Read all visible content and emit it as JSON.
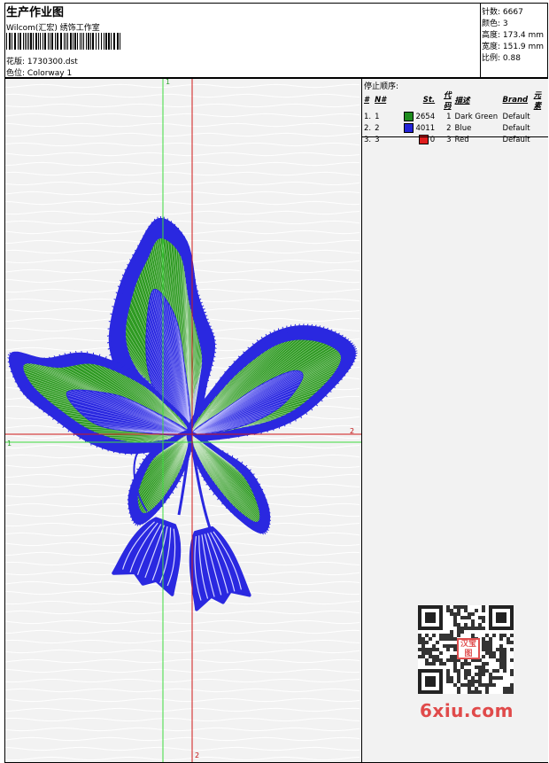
{
  "window": {
    "title": "生产作业图",
    "company": "Wilcom(汇宏) 绣饰工作室"
  },
  "header": {
    "design_label": "花版:",
    "design_value": "1730300.dst",
    "colorway_label": "色位:",
    "colorway_value": "Colorway 1"
  },
  "stats": {
    "stitches": "针数: 6667",
    "colors": "颜色: 3",
    "height": "高度: 173.4 mm",
    "width": "宽度: 151.9 mm",
    "scale": "比例: 0.88"
  },
  "stop_sequence": {
    "header": "停止顺序:",
    "columns": [
      "#",
      "N#",
      "St.",
      "代码",
      "描述",
      "Brand",
      "元素"
    ],
    "rows": [
      {
        "idx": "1.",
        "n": "1",
        "swatch": "#1e8c1e",
        "st": "2654",
        "code": "1",
        "desc": "Dark Green",
        "brand": "Default",
        "element": ""
      },
      {
        "idx": "2.",
        "n": "2",
        "swatch": "#2323d8",
        "st": "4011",
        "code": "2",
        "desc": "Blue",
        "brand": "Default",
        "element": ""
      },
      {
        "idx": "3.",
        "n": "3",
        "swatch": "#e01e1e",
        "st": "0",
        "code": "3",
        "desc": "Red",
        "brand": "Default",
        "element": ""
      }
    ]
  },
  "axes": {
    "green_top": "1",
    "green_left": "1",
    "red_right": "2",
    "red_bottom": "2"
  },
  "colors": {
    "green_thread": "#2e9a22",
    "blue_thread": "#2a28e0",
    "axis_green": "#3ddc3d",
    "axis_red": "#d01818"
  },
  "qr": {
    "stamp_text": "汉宝图"
  },
  "watermark": "6xiu.com"
}
